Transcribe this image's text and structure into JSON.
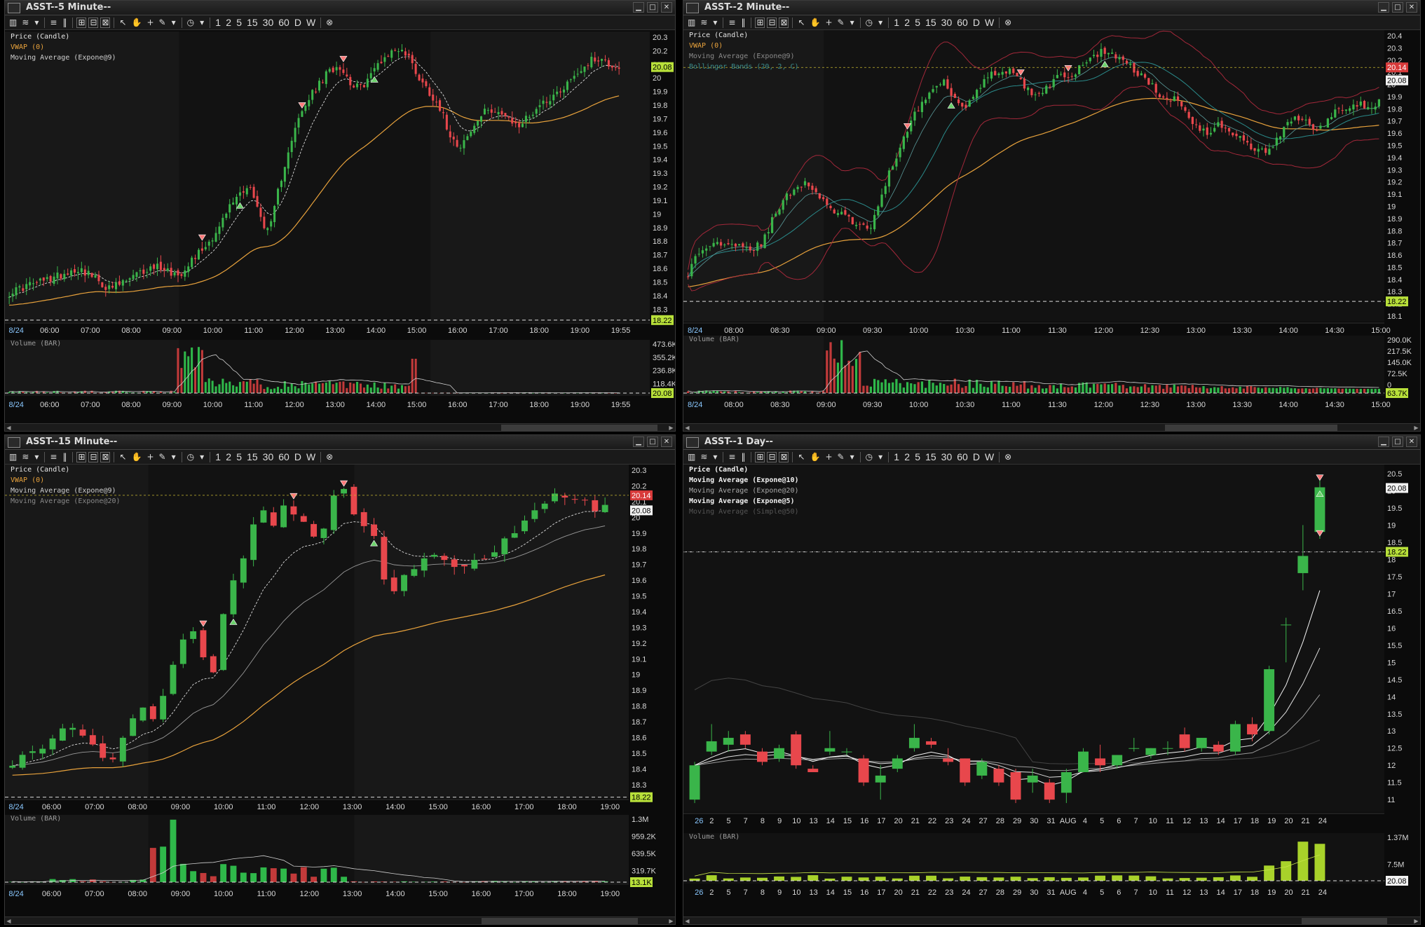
{
  "panes": [
    {
      "id": "p5",
      "title": "ASST--5 Minute--",
      "legend": [
        {
          "text": "Price (Candle)",
          "color": "#e6e6e6"
        },
        {
          "text": "VWAP (0)",
          "color": "#e8a23c"
        },
        {
          "text": "Moving Average (Expone@9)",
          "color": "#cfcfcf"
        }
      ],
      "volume_label": "Volume (BAR)",
      "time_labels": [
        "8/24",
        "06:00",
        "07:00",
        "08:00",
        "09:00",
        "10:00",
        "11:00",
        "12:00",
        "13:00",
        "14:00",
        "15:00",
        "16:00",
        "17:00",
        "18:00",
        "19:00",
        "19:55"
      ],
      "price_axis": [
        "20.3",
        "20.2",
        "20.1",
        "20",
        "19.9",
        "19.8",
        "19.7",
        "19.6",
        "19.5",
        "19.4",
        "19.3",
        "19.2",
        "19.1",
        "19",
        "18.9",
        "18.8",
        "18.7",
        "18.6",
        "18.5",
        "18.4",
        "18.3"
      ],
      "volume_axis": [
        "473.6K",
        "355.2K",
        "236.8K",
        "118.4K"
      ],
      "last_price": "20.08",
      "ref_price": "18.22",
      "last_volume": "20.08"
    },
    {
      "id": "p2",
      "title": "ASST--2 Minute--",
      "legend": [
        {
          "text": "Price (Candle)",
          "color": "#e6e6e6"
        },
        {
          "text": "VWAP (0)",
          "color": "#e8a23c"
        },
        {
          "text": "Moving Average (Expone@9)",
          "color": "#8a8a8a"
        },
        {
          "text": "Bollinger Bands (20, 2, C)",
          "color": "#3a8a8a"
        }
      ],
      "volume_label": "Volume (BAR)",
      "time_labels": [
        "8/24",
        "08:00",
        "08:30",
        "09:00",
        "09:30",
        "10:00",
        "10:30",
        "11:00",
        "11:30",
        "12:00",
        "12:30",
        "13:00",
        "13:30",
        "14:00",
        "14:30",
        "15:00"
      ],
      "price_axis": [
        "20.4",
        "20.3",
        "20.2",
        "20.1",
        "20",
        "19.9",
        "19.8",
        "19.7",
        "19.6",
        "19.5",
        "19.4",
        "19.3",
        "19.2",
        "19.1",
        "19",
        "18.9",
        "18.8",
        "18.7",
        "18.6",
        "18.5",
        "18.4",
        "18.3",
        "18.2",
        "18.1"
      ],
      "volume_axis": [
        "290.0K",
        "217.5K",
        "145.0K",
        "72.5K",
        "0"
      ],
      "last_price": "20.14",
      "last_price2": "20.08",
      "ref_price": "18.22",
      "last_volume": "63.7K"
    },
    {
      "id": "p15",
      "title": "ASST--15 Minute--",
      "legend": [
        {
          "text": "Price (Candle)",
          "color": "#e6e6e6"
        },
        {
          "text": "VWAP (0)",
          "color": "#e8a23c"
        },
        {
          "text": "Moving Average (Expone@9)",
          "color": "#cfcfcf"
        },
        {
          "text": "Moving Average (Expone@20)",
          "color": "#8a8a8a"
        }
      ],
      "volume_label": "Volume (BAR)",
      "time_labels": [
        "8/24",
        "06:00",
        "07:00",
        "08:00",
        "09:00",
        "10:00",
        "11:00",
        "12:00",
        "13:00",
        "14:00",
        "15:00",
        "16:00",
        "17:00",
        "18:00",
        "19:00"
      ],
      "price_axis": [
        "20.3",
        "20.2",
        "20.1",
        "20",
        "19.9",
        "19.8",
        "19.7",
        "19.6",
        "19.5",
        "19.4",
        "19.3",
        "19.2",
        "19.1",
        "19",
        "18.9",
        "18.8",
        "18.7",
        "18.6",
        "18.5",
        "18.4",
        "18.3"
      ],
      "volume_axis": [
        "1.3M",
        "959.2K",
        "639.5K",
        "319.7K"
      ],
      "last_price": "20.14",
      "last_price2": "20.08",
      "ref_price": "18.22",
      "last_volume": "13.1K"
    },
    {
      "id": "pd",
      "title": "ASST--1 Day--",
      "legend": [
        {
          "text": "Price (Candle)",
          "color": "#f2f2f2"
        },
        {
          "text": "Moving Average (Expone@10)",
          "color": "#f2f2f2"
        },
        {
          "text": "Moving Average (Expone@20)",
          "color": "#aaaaaa"
        },
        {
          "text": "Moving Average (Expone@5)",
          "color": "#f2f2f2"
        },
        {
          "text": "Moving Average (Simple@50)",
          "color": "#555555"
        }
      ],
      "volume_label": "Volume (BAR)",
      "time_labels": [
        "26",
        "2",
        "5",
        "7",
        "8",
        "9",
        "10",
        "13",
        "14",
        "15",
        "16",
        "17",
        "20",
        "21",
        "22",
        "23",
        "24",
        "27",
        "28",
        "29",
        "30",
        "31",
        "AUG",
        "4",
        "5",
        "6",
        "7",
        "10",
        "11",
        "12",
        "13",
        "14",
        "17",
        "18",
        "19",
        "20",
        "21",
        "24"
      ],
      "price_axis": [
        "20.5",
        "20",
        "19.5",
        "19",
        "18.5",
        "18",
        "17.5",
        "17",
        "16.5",
        "16",
        "15.5",
        "15",
        "14.5",
        "14",
        "13.5",
        "13",
        "12.5",
        "12",
        "11.5",
        "11"
      ],
      "volume_axis": [
        "1.37M",
        "7.5M"
      ],
      "last_price": "20.08",
      "ref_price": "18.22",
      "last_volume": "20.08"
    }
  ],
  "toolbar": {
    "periods": [
      "1",
      "2",
      "5",
      "15",
      "30",
      "60",
      "D",
      "W"
    ]
  },
  "colors": {
    "up": "#3ab54a",
    "down": "#e8474c",
    "vwap": "#e8a23c",
    "ema": "#d0d0d0",
    "bb": "#a3283a",
    "bbmid": "#2a8a8a",
    "last": "#b8e03a",
    "neg": "#d83a3a"
  },
  "icons": [
    "chart-logo-icon",
    "minimize-icon",
    "maximize-icon",
    "close-icon",
    "cursor-icon",
    "hand-icon",
    "crosshair-icon",
    "pencil-icon",
    "clock-icon",
    "settings-icon"
  ],
  "chart_data": [
    {
      "type": "candlestick",
      "pane": "ASST--5 Minute--",
      "ylim": [
        18.25,
        20.3
      ],
      "series": [
        {
          "name": "Price (Candle)",
          "x_range": [
            "05:00",
            "19:55"
          ],
          "close_path": [
            18.42,
            18.45,
            18.48,
            18.5,
            18.52,
            18.55,
            18.58,
            18.6,
            18.56,
            18.5,
            18.45,
            18.48,
            18.52,
            18.56,
            18.6,
            18.62,
            18.58,
            18.55,
            18.65,
            18.72,
            18.8,
            18.9,
            19.05,
            19.15,
            19.22,
            19.0,
            18.85,
            19.2,
            19.5,
            19.7,
            19.85,
            19.95,
            20.05,
            20.1,
            19.98,
            19.92,
            20.0,
            20.12,
            20.18,
            20.22,
            20.15,
            20.0,
            19.9,
            19.8,
            19.6,
            19.5,
            19.58,
            19.7,
            19.78,
            19.75,
            19.68,
            19.65,
            19.72,
            19.8,
            19.85,
            19.9,
            19.98,
            20.05,
            20.12,
            20.15,
            20.1,
            20.08
          ]
        },
        {
          "name": "VWAP (0)",
          "path": [
            18.45,
            18.48,
            18.55,
            18.65,
            18.8,
            19.0,
            19.2,
            19.35,
            19.45,
            19.52,
            19.57,
            19.6,
            19.62,
            19.63,
            19.64,
            19.64,
            19.64,
            19.64
          ]
        },
        {
          "name": "Moving Average (Expone@9)"
        }
      ],
      "volume": {
        "peak": "473.6K"
      }
    },
    {
      "type": "candlestick",
      "pane": "ASST--2 Minute--",
      "ylim": [
        18.1,
        20.4
      ],
      "series": [
        {
          "name": "Price (Candle)",
          "x_range": [
            "07:40",
            "15:10"
          ],
          "close_path": [
            18.45,
            18.62,
            18.68,
            18.7,
            18.72,
            18.68,
            18.65,
            18.7,
            18.9,
            19.05,
            19.15,
            19.2,
            19.12,
            19.0,
            18.95,
            18.9,
            18.85,
            18.8,
            19.0,
            19.3,
            19.5,
            19.7,
            19.85,
            19.95,
            20.05,
            19.9,
            19.8,
            19.95,
            20.05,
            20.1,
            20.12,
            20.05,
            19.95,
            19.9,
            20.0,
            20.1,
            20.05,
            20.15,
            20.22,
            20.28,
            20.25,
            20.18,
            20.12,
            20.05,
            19.95,
            19.85,
            19.9,
            19.75,
            19.65,
            19.6,
            19.68,
            19.62,
            19.55,
            19.48,
            19.45,
            19.5,
            19.62,
            19.75,
            19.7,
            19.6,
            19.7,
            19.78,
            19.82,
            19.85,
            19.8,
            19.85
          ]
        },
        {
          "name": "VWAP (0)"
        },
        {
          "name": "Moving Average (Expone@9)"
        },
        {
          "name": "Bollinger Bands (20, 2, C)"
        }
      ],
      "volume": {
        "peak": "290.0K"
      }
    },
    {
      "type": "candlestick",
      "pane": "ASST--15 Minute--",
      "ylim": [
        18.25,
        20.3
      ],
      "series": [
        {
          "name": "Price (Candle)",
          "x_range": [
            "05:00",
            "19:45"
          ],
          "close_path": [
            18.45,
            18.5,
            18.48,
            18.52,
            18.6,
            18.65,
            18.62,
            18.55,
            18.5,
            18.42,
            18.6,
            18.75,
            18.8,
            18.72,
            18.9,
            19.15,
            19.3,
            19.22,
            18.9,
            19.35,
            19.6,
            19.75,
            19.95,
            20.05,
            19.9,
            20.12,
            20.0,
            19.92,
            19.85,
            20.1,
            20.18,
            20.05,
            19.95,
            19.85,
            19.6,
            19.5,
            19.65,
            19.72,
            19.78,
            19.72,
            19.68,
            19.65,
            19.7,
            19.75,
            19.8,
            19.85,
            19.92,
            20.0,
            20.05,
            20.15,
            20.12,
            20.08,
            20.1,
            20.05,
            20.08
          ]
        },
        {
          "name": "VWAP (0)"
        },
        {
          "name": "Moving Average (Expone@9)"
        },
        {
          "name": "Moving Average (Expone@20)"
        }
      ],
      "volume": {
        "peak": "1.3M"
      }
    },
    {
      "type": "candlestick",
      "pane": "ASST--1 Day--",
      "ylim": [
        10.8,
        20.6
      ],
      "categories": [
        "26",
        "2",
        "5",
        "7",
        "8",
        "9",
        "10",
        "13",
        "14",
        "15",
        "16",
        "17",
        "20",
        "21",
        "22",
        "23",
        "24",
        "27",
        "28",
        "29",
        "30",
        "31",
        "AUG",
        "4",
        "5",
        "6",
        "7",
        "10",
        "11",
        "12",
        "13",
        "14",
        "17",
        "18",
        "19",
        "20",
        "21",
        "24"
      ],
      "ohlc": [
        [
          11.0,
          12.1,
          10.9,
          12.0
        ],
        [
          12.4,
          13.2,
          12.3,
          12.7
        ],
        [
          12.6,
          13.0,
          12.4,
          12.8
        ],
        [
          12.9,
          13.0,
          12.5,
          12.6
        ],
        [
          12.4,
          12.5,
          12.0,
          12.1
        ],
        [
          12.2,
          12.6,
          12.1,
          12.5
        ],
        [
          12.9,
          13.0,
          11.9,
          12.0
        ],
        [
          11.9,
          12.0,
          11.8,
          11.8
        ],
        [
          12.4,
          13.0,
          12.3,
          12.5
        ],
        [
          12.4,
          12.5,
          12.3,
          12.4
        ],
        [
          12.2,
          12.3,
          11.4,
          11.5
        ],
        [
          11.5,
          12.0,
          11.0,
          11.7
        ],
        [
          11.9,
          12.3,
          11.8,
          12.2
        ],
        [
          12.5,
          13.2,
          12.4,
          12.8
        ],
        [
          12.7,
          12.8,
          12.5,
          12.6
        ],
        [
          12.2,
          12.5,
          12.0,
          12.1
        ],
        [
          12.2,
          12.2,
          11.4,
          11.5
        ],
        [
          11.7,
          12.2,
          11.6,
          12.1
        ],
        [
          11.9,
          12.0,
          11.4,
          11.5
        ],
        [
          11.8,
          11.9,
          10.9,
          11.0
        ],
        [
          11.5,
          11.9,
          11.2,
          11.7
        ],
        [
          11.5,
          11.6,
          10.9,
          11.0
        ],
        [
          11.2,
          11.9,
          10.9,
          11.8
        ],
        [
          11.8,
          12.5,
          11.8,
          12.4
        ],
        [
          12.2,
          12.6,
          11.8,
          12.0
        ],
        [
          12.0,
          12.3,
          11.9,
          12.3
        ],
        [
          12.5,
          12.8,
          12.4,
          12.5
        ],
        [
          12.3,
          12.5,
          12.2,
          12.5
        ],
        [
          12.5,
          12.7,
          12.3,
          12.5
        ],
        [
          12.9,
          13.1,
          12.4,
          12.5
        ],
        [
          12.5,
          12.8,
          12.4,
          12.8
        ],
        [
          12.6,
          12.7,
          12.3,
          12.4
        ],
        [
          12.4,
          13.3,
          12.3,
          13.2
        ],
        [
          13.2,
          13.4,
          12.7,
          12.9
        ],
        [
          13.0,
          14.9,
          12.9,
          14.8
        ],
        [
          16.1,
          16.3,
          15.0,
          16.1
        ],
        [
          17.6,
          19.0,
          17.1,
          18.1
        ],
        [
          18.8,
          20.3,
          18.6,
          20.1
        ]
      ],
      "series": [
        {
          "name": "Moving Average (Expone@10)"
        },
        {
          "name": "Moving Average (Expone@20)"
        },
        {
          "name": "Moving Average (Expone@5)"
        },
        {
          "name": "Moving Average (Simple@50)"
        }
      ],
      "volume": {
        "peak": "7.5M",
        "last": "1.37M"
      }
    }
  ]
}
